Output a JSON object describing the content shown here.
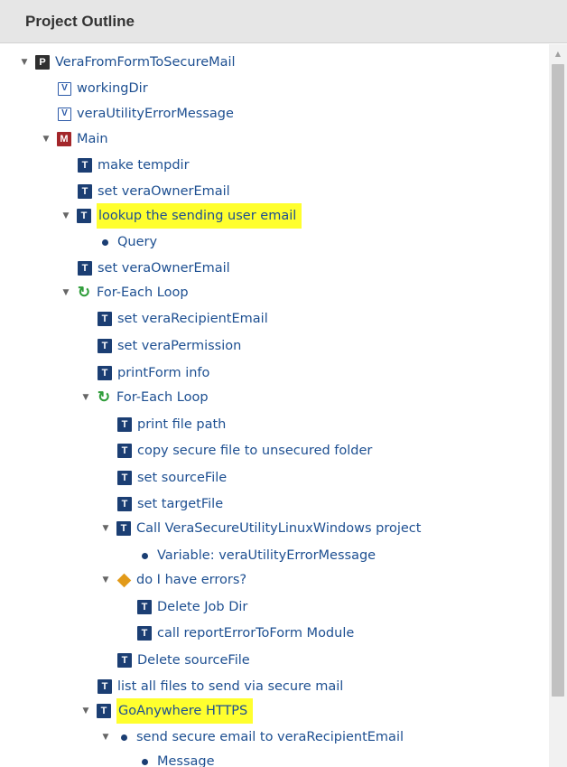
{
  "panel": {
    "title": "Project Outline"
  },
  "tree": {
    "project": "VeraFromFormToSecureMail",
    "variables": [
      "workingDir",
      "veraUtilityErrorMessage"
    ],
    "module_main": "Main",
    "task_make_tempdir": "make tempdir",
    "task_set_owner_1": "set veraOwnerEmail",
    "task_lookup": "lookup the sending user email",
    "sub_query": "Query",
    "task_set_owner_2": "set veraOwnerEmail",
    "loop_outer": "For-Each Loop",
    "task_set_recipient": "set veraRecipientEmail",
    "task_set_permission": "set veraPermission",
    "task_printform": "printForm info",
    "loop_inner": "For-Each Loop",
    "task_print_path": "print file path",
    "task_copy_secure": "copy secure file to unsecured folder",
    "task_set_source": "set sourceFile",
    "task_set_target": "set targetFile",
    "task_call_project": "Call VeraSecureUtilityLinuxWindows project",
    "sub_variable": "Variable: veraUtilityErrorMessage",
    "cond_errors": "do I have errors?",
    "task_delete_job": "Delete Job Dir",
    "task_call_report": "call reportErrorToForm Module",
    "task_delete_source": "Delete sourceFile",
    "task_list_files": "list all files to send via secure mail",
    "task_goanywhere": "GoAnywhere HTTPS",
    "sub_send_secure": "send secure email to veraRecipientEmail",
    "sub_message": "Message"
  },
  "icons": {
    "project": "P",
    "variable": "V",
    "module": "M",
    "task": "T",
    "loop": "↻"
  },
  "colors": {
    "link_text": "#1d4f91",
    "highlight": "#ffff2e",
    "module_icon": "#a3262a",
    "task_icon": "#1b3e73",
    "loop_icon": "#2f9d3a",
    "condition_icon": "#e29a19"
  }
}
